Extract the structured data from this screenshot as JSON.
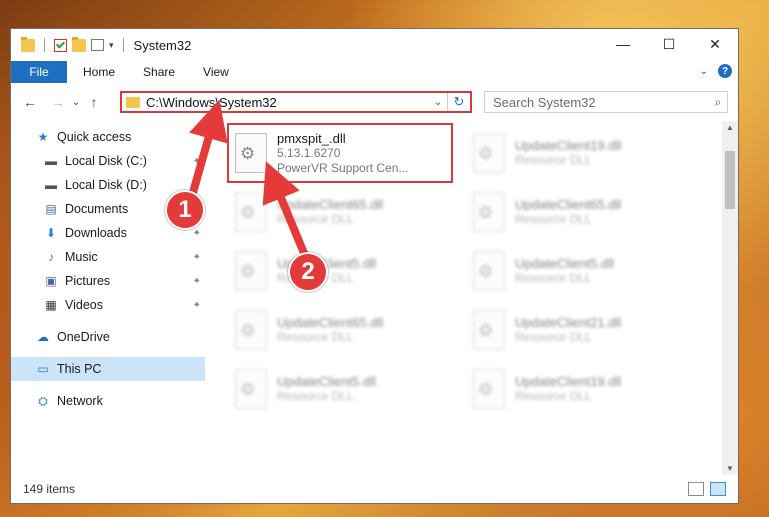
{
  "window": {
    "title": "System32",
    "controls": {
      "minimize": "—",
      "maximize": "☐",
      "close": "✕"
    }
  },
  "ribbon": {
    "file_tab": "File",
    "tabs": [
      "Home",
      "Share",
      "View"
    ],
    "expand_glyph": "⌄",
    "help_glyph": "?"
  },
  "nav": {
    "back": "←",
    "forward": "→",
    "recent": "⌄",
    "up": "↑",
    "address": "C:\\Windows\\System32",
    "address_dropdown": "⌄",
    "refresh": "↻",
    "search_placeholder": "Search System32",
    "search_glyph": "⌕"
  },
  "sidebar": {
    "items": [
      {
        "label": "Quick access",
        "icon": "star-icon",
        "glyph": "★"
      },
      {
        "label": "Local Disk (C:)",
        "icon": "drive-icon",
        "glyph": "▬"
      },
      {
        "label": "Local Disk (D:)",
        "icon": "drive-icon",
        "glyph": "▬"
      },
      {
        "label": "Documents",
        "icon": "document-icon",
        "glyph": "▤"
      },
      {
        "label": "Downloads",
        "icon": "download-icon",
        "glyph": "⬇"
      },
      {
        "label": "Music",
        "icon": "music-icon",
        "glyph": "♪"
      },
      {
        "label": "Pictures",
        "icon": "pictures-icon",
        "glyph": "▣"
      },
      {
        "label": "Videos",
        "icon": "videos-icon",
        "glyph": "▦"
      },
      {
        "label": "OneDrive",
        "icon": "cloud-icon",
        "glyph": "☁"
      },
      {
        "label": "This PC",
        "icon": "computer-icon",
        "glyph": "▭"
      },
      {
        "label": "Network",
        "icon": "network-icon",
        "glyph": "⛭"
      }
    ],
    "pin_glyph": "📌"
  },
  "files": [
    {
      "name": "pmxspit_.dll",
      "line2": "5.13.1.6270",
      "line3": "PowerVR Support Cen..."
    },
    {
      "name": "UpdateClient19.dll",
      "line2": "Resource DLL"
    },
    {
      "name": "UpdateClient65.dll",
      "line2": "Resource DLL"
    },
    {
      "name": "UpdateClient65.dll",
      "line2": "Resource DLL"
    },
    {
      "name": "UpdateClient5.dll",
      "line2": "Resource DLL"
    },
    {
      "name": "UpdateClient5.dll",
      "line2": "Resource DLL"
    },
    {
      "name": "UpdateClient65.dll",
      "line2": "Resource DLL"
    },
    {
      "name": "UpdateClient21.dll",
      "line2": "Resource DLL"
    },
    {
      "name": "UpdateClient5.dll",
      "line2": "Resource DLL"
    },
    {
      "name": "UpdateClient19.dll",
      "line2": "Resource DLL"
    }
  ],
  "status": {
    "count": "149 items"
  },
  "annotations": {
    "badge1": "1",
    "badge2": "2",
    "color": "#e43a3a"
  }
}
